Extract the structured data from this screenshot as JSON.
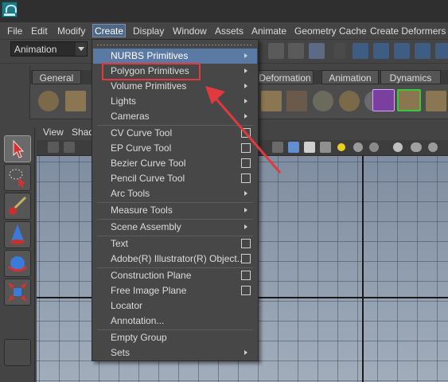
{
  "menubar": {
    "items": [
      "File",
      "Edit",
      "Modify",
      "Create",
      "Display",
      "Window",
      "Assets",
      "Animate",
      "Geometry Cache",
      "Create Deformers"
    ]
  },
  "status_line": {
    "mode": "Animation"
  },
  "shelf": {
    "tabs": [
      "General",
      "Deformation",
      "Animation",
      "Dynamics"
    ]
  },
  "viewport": {
    "menus": [
      "View",
      "Shad"
    ]
  },
  "create_menu": {
    "items": [
      {
        "label": "NURBS Primitives",
        "submenu": true,
        "highlighted": true
      },
      {
        "label": "Polygon Primitives",
        "submenu": true
      },
      {
        "label": "Volume Primitives",
        "submenu": true
      },
      {
        "label": "Lights",
        "submenu": true
      },
      {
        "label": "Cameras",
        "submenu": true
      },
      {
        "label": "CV Curve Tool",
        "option_box": true
      },
      {
        "label": "EP Curve Tool",
        "option_box": true
      },
      {
        "label": "Bezier Curve Tool",
        "option_box": true
      },
      {
        "label": "Pencil Curve Tool",
        "option_box": true
      },
      {
        "label": "Arc Tools",
        "submenu": true
      },
      {
        "label": "Measure Tools",
        "submenu": true
      },
      {
        "label": "Scene Assembly",
        "submenu": true
      },
      {
        "label": "Text",
        "option_box": true
      },
      {
        "label": "Adobe(R) Illustrator(R) Object...",
        "option_box": true
      },
      {
        "label": "Construction Plane",
        "option_box": true
      },
      {
        "label": "Free Image Plane",
        "option_box": true
      },
      {
        "label": "Locator"
      },
      {
        "label": "Annotation..."
      },
      {
        "label": "Empty Group"
      },
      {
        "label": "Sets",
        "submenu": true
      }
    ]
  },
  "colors": {
    "highlight": "#5b7aa3",
    "annotation_red": "#e0393e",
    "viewport_bg": "#8a97a8"
  }
}
